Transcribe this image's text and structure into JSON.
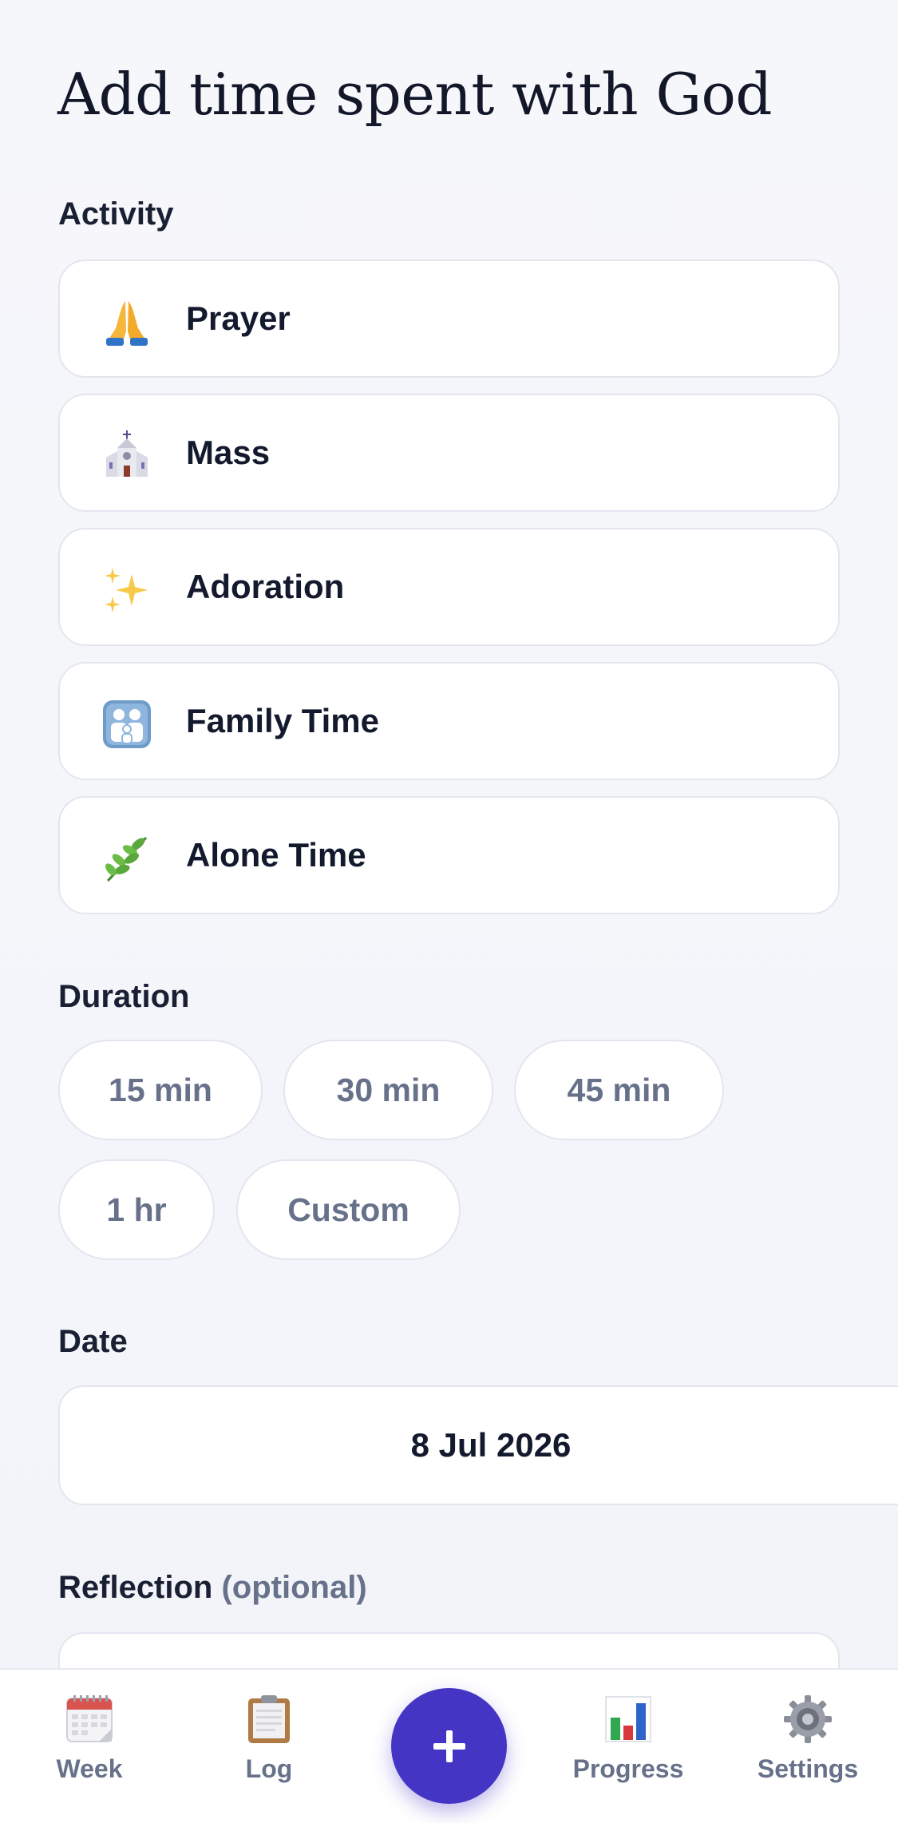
{
  "header": {
    "title": "Add time spent with God"
  },
  "activity": {
    "label": "Activity",
    "items": [
      {
        "label": "Prayer",
        "icon": "praying-hands-icon"
      },
      {
        "label": "Mass",
        "icon": "church-icon"
      },
      {
        "label": "Adoration",
        "icon": "sparkles-icon"
      },
      {
        "label": "Family Time",
        "icon": "family-icon"
      },
      {
        "label": "Alone Time",
        "icon": "herb-icon"
      }
    ]
  },
  "duration": {
    "label": "Duration",
    "options": [
      "15 min",
      "30 min",
      "45 min",
      "1 hr",
      "Custom"
    ]
  },
  "date": {
    "label": "Date",
    "value": "8 Jul 2026"
  },
  "reflection": {
    "label": "Reflection",
    "optional": "(optional)"
  },
  "tabbar": {
    "tabs": [
      {
        "label": "Week",
        "icon": "calendar-icon"
      },
      {
        "label": "Log",
        "icon": "clipboard-icon"
      },
      {
        "label": "Progress",
        "icon": "bar-chart-icon"
      },
      {
        "label": "Settings",
        "icon": "gear-icon"
      }
    ],
    "add_icon": "plus-icon"
  },
  "colors": {
    "accent": "#4535c4",
    "background": "#f3f5fa",
    "muted_text": "#67718a"
  }
}
